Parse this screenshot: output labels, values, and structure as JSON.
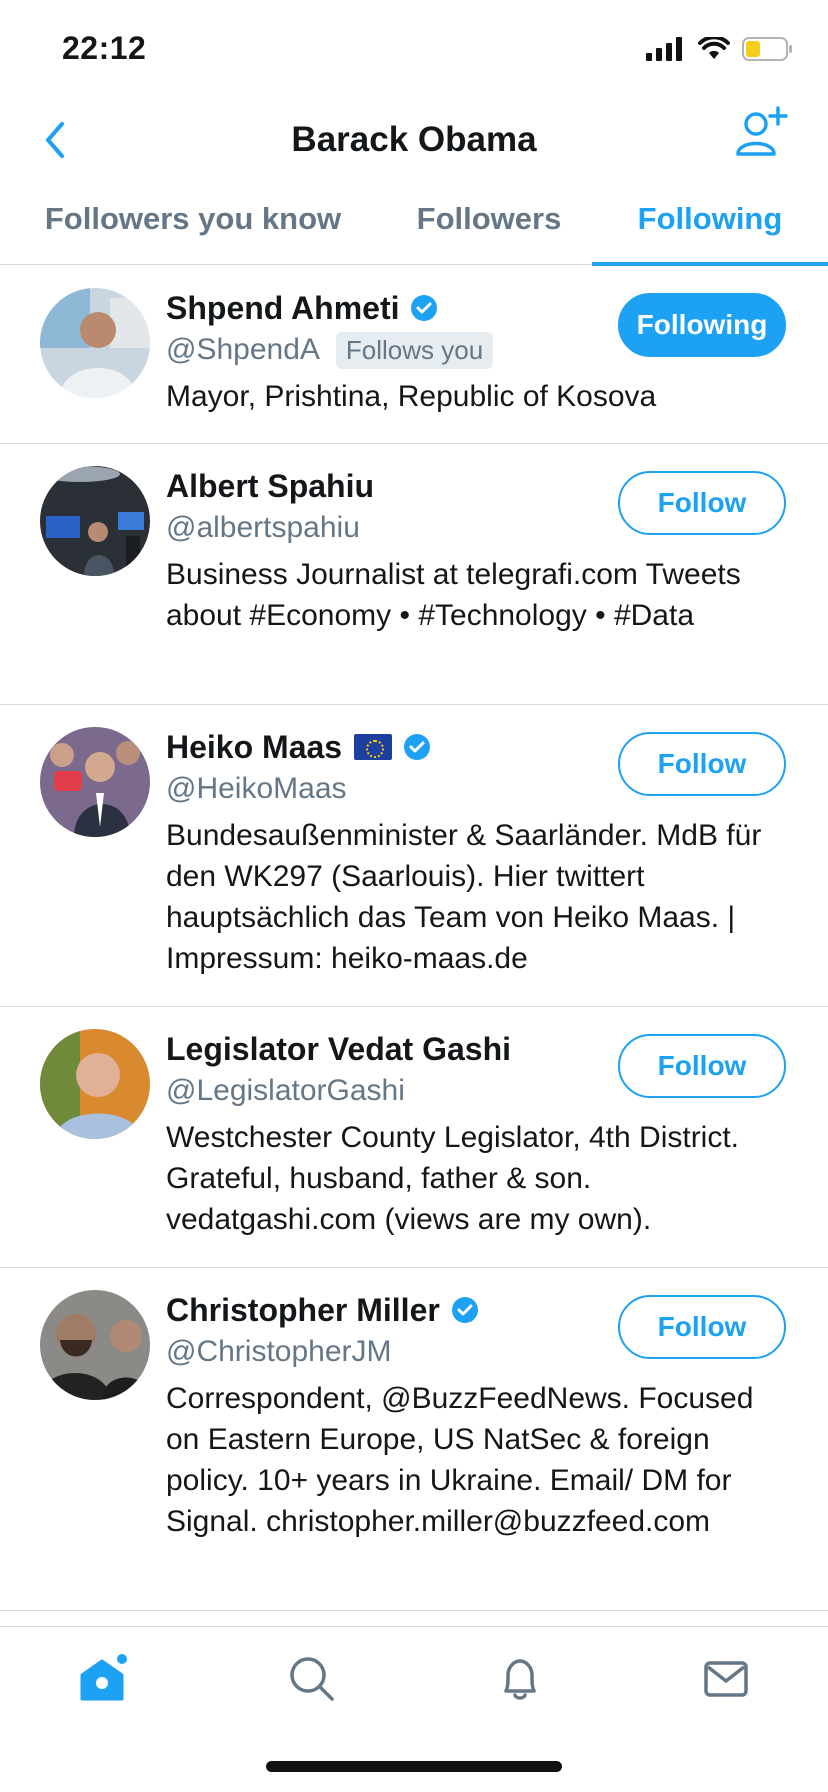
{
  "status_bar": {
    "time": "22:12"
  },
  "header": {
    "title": "Barack Obama"
  },
  "tabs": [
    {
      "label": "Followers you know"
    },
    {
      "label": "Followers"
    },
    {
      "label": "Following",
      "active": true
    }
  ],
  "users": [
    {
      "name": "Shpend Ahmeti",
      "verified": true,
      "handle": "@ShpendA",
      "follows_you": "Follows you",
      "bio": "Mayor, Prishtina, Republic of Kosova",
      "button": "Following"
    },
    {
      "name": "Albert Spahiu",
      "verified": false,
      "handle": "@albertspahiu",
      "bio": "Business Journalist at telegrafi.com Tweets about #Economy • #Technology • #Data",
      "button": "Follow"
    },
    {
      "name": "Heiko Maas",
      "verified": true,
      "handle": "@HeikoMaas",
      "bio": "Bundesaußenminister & Saarländer. MdB für den WK297 (Saarlouis). Hier twittert hauptsächlich das Team von Heiko Maas. | Impressum: heiko-maas.de",
      "button": "Follow"
    },
    {
      "name": "Legislator Vedat Gashi",
      "verified": false,
      "handle": "@LegislatorGashi",
      "bio": "Westchester County Legislator, 4th District. Grateful, husband, father & son. vedatgashi.com (views are my own).",
      "button": "Follow"
    },
    {
      "name": "Christopher Miller",
      "verified": true,
      "handle": "@ChristopherJM",
      "bio": "Correspondent, @BuzzFeedNews. Focused on Eastern Europe, US NatSec & foreign policy. 10+ years in Ukraine. Email/ DM for Signal. christopher.miller@buzzfeed.com",
      "button": "Follow"
    }
  ],
  "bottom_nav": [
    {
      "icon": "home-icon",
      "active": true
    },
    {
      "icon": "search-icon"
    },
    {
      "icon": "bell-icon"
    },
    {
      "icon": "mail-icon"
    }
  ],
  "colors": {
    "accent": "#1da1f2",
    "secondary_text": "#657786"
  }
}
